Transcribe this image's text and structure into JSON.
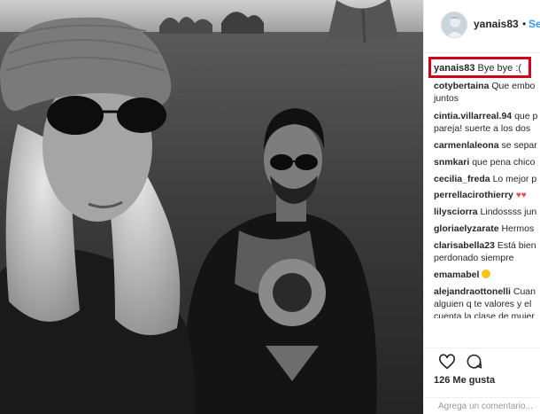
{
  "post": {
    "username": "yanais83",
    "separator": "•",
    "follow_label": "Seguir",
    "caption_user": "yanais83",
    "caption_text": "Bye bye :(",
    "likes": "126 Me gusta",
    "age": "",
    "add_comment_placeholder": "Agrega un comentario..."
  },
  "comments": [
    {
      "user": "cotybertaina",
      "text": "Que embo",
      "cont": "juntos"
    },
    {
      "user": "cintia.villarreal.94",
      "text": "que p",
      "cont": "pareja! suerte a los dos"
    },
    {
      "user": "carmenlaleona",
      "text": "se separ",
      "cont": ""
    },
    {
      "user": "snmkari",
      "text": "que pena chico",
      "cont": ""
    },
    {
      "user": "cecilia_freda",
      "text": "Lo mejor p",
      "cont": ""
    },
    {
      "user": "perrellacirothierry",
      "text": "",
      "cont": ""
    },
    {
      "user": "lilysciorra",
      "text": "Lindossss jun",
      "cont": ""
    },
    {
      "user": "gloriaelyzarate",
      "text": "Hermos",
      "cont": ""
    },
    {
      "user": "clarisabella23",
      "text": "Está bien",
      "cont": "perdonado siempre"
    },
    {
      "user": "emamabel",
      "text": "",
      "cont": ""
    },
    {
      "user": "alejandraottonelli",
      "text": "Cuan",
      "cont": "alguien q te valores y el"
    },
    {
      "user": "",
      "text": "cuenta la clase de mujer",
      "cont": ""
    }
  ],
  "icons": {
    "like": "heart-icon",
    "comment": "comment-bubble-icon"
  },
  "colors": {
    "highlight": "#d0021b",
    "follow": "#3897f0",
    "heart": "#ed4956"
  }
}
